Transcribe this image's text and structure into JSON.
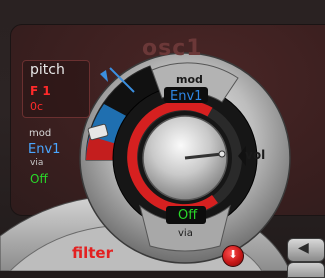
{
  "oscillator": {
    "title": "osc1"
  },
  "pitch": {
    "label": "pitch",
    "note": "F 1",
    "octave": "0c"
  },
  "pitch_mod": {
    "mod_label": "mod",
    "source": "Env1",
    "via_label": "via",
    "via_value": "Off"
  },
  "top_mod": {
    "mod_label": "mod",
    "source": "Env1"
  },
  "volume": {
    "label": "vol",
    "level_fraction": 0.62
  },
  "bottom_via": {
    "value": "Off",
    "via_label": "via"
  },
  "filter": {
    "label": "filter"
  },
  "buttons": {
    "down_arrow": "⬇",
    "left_arrow": "◀"
  },
  "colors": {
    "red_accent": "#e32020",
    "blue_value": "#2f86e6",
    "green_value": "#29d829",
    "panel_red": "#4a2626"
  }
}
